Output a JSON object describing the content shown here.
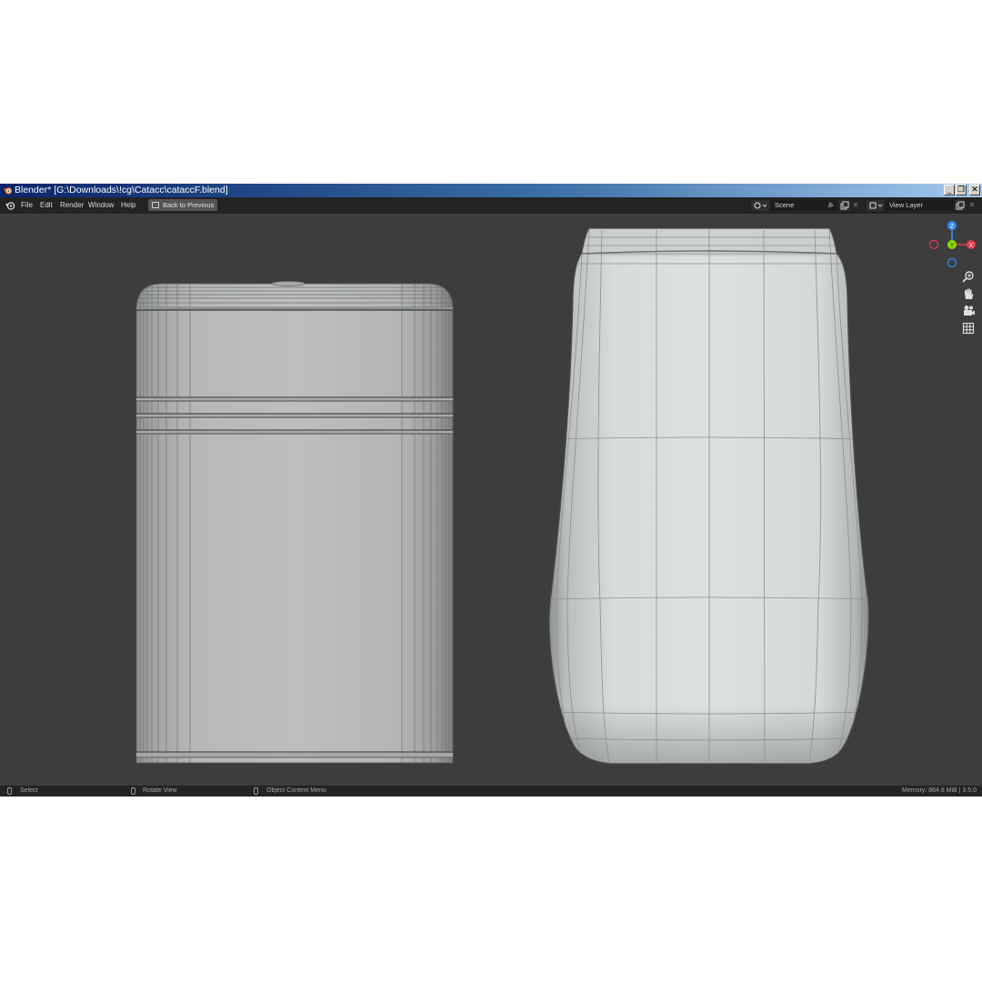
{
  "window": {
    "title": "Blender* [G:\\Downloads\\!cg\\Catacc\\cataccF.blend]",
    "controls": {
      "minimize": "_",
      "restore": "❐",
      "close": "✕"
    }
  },
  "menu": {
    "items": [
      "File",
      "Edit",
      "Render",
      "Window",
      "Help"
    ],
    "back_button": "Back to Previous"
  },
  "header": {
    "scene_label": "Scene",
    "view_layer_label": "View Layer",
    "pin_icon": "pin-icon",
    "close_glyph": "✕"
  },
  "gizmo": {
    "axes": {
      "z": "Z",
      "y": "Y",
      "x": "X"
    },
    "colors": {
      "x": "#e8394d",
      "y": "#8bdc00",
      "z": "#2c8fff"
    }
  },
  "viewport_tools": [
    "zoom-icon",
    "hand-icon",
    "camera-icon",
    "grid-icon"
  ],
  "status": {
    "select": "Select",
    "rotate": "Rotate View",
    "context": "Object Context Menu",
    "memory": "Memory: 864.8 MiB | 3.5.0"
  },
  "colors": {
    "viewport_bg": "#3d3d3d",
    "header_bg": "#232323",
    "title_gradient_start": "#0a246a",
    "mesh_wire": "#6f7575"
  }
}
